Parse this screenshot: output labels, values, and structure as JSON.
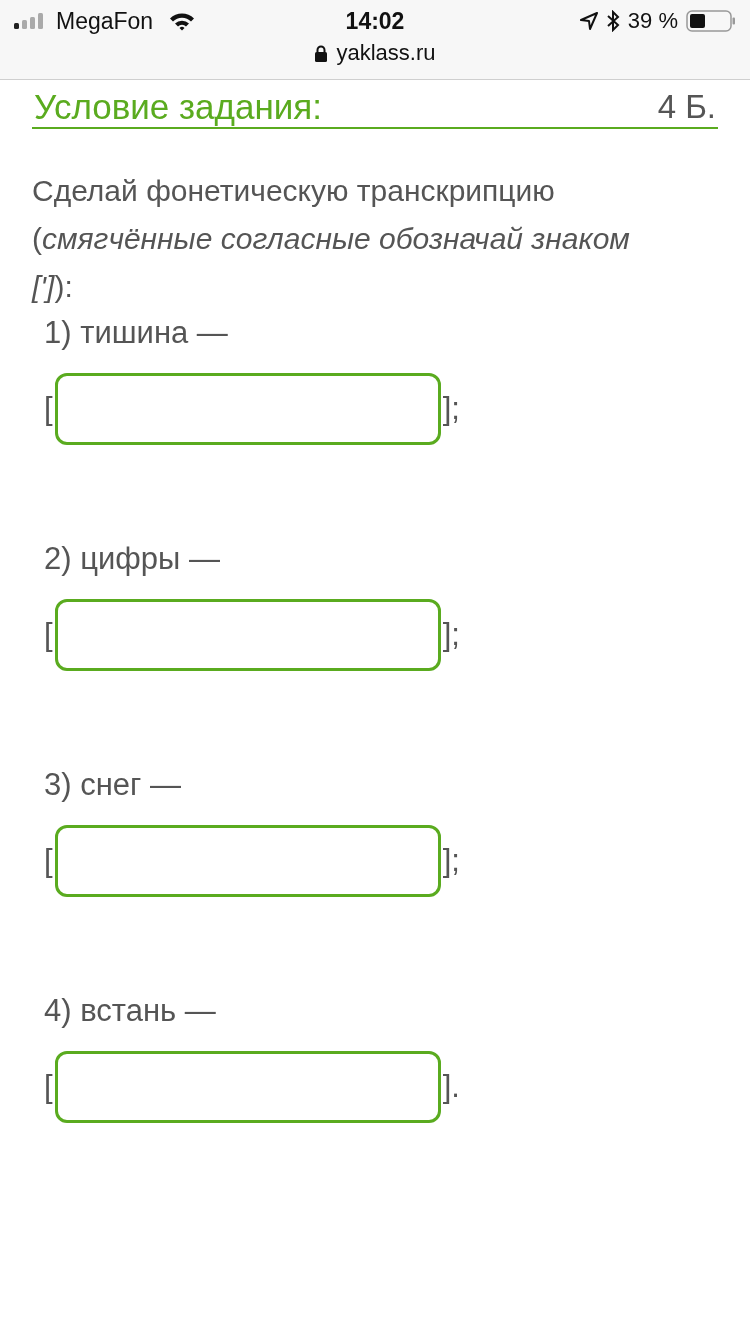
{
  "status_bar": {
    "carrier": "MegaFon",
    "time": "14:02",
    "url": "yaklass.ru",
    "battery": "39 %"
  },
  "header": {
    "title": "Условие задания:",
    "points": "4 Б."
  },
  "instruction": "Сделай фонетическую транскрипцию (*смягчённые согласные обозначай знаком [']*):",
  "items": [
    {
      "word": "1) тишина —",
      "open": "[",
      "close": "];"
    },
    {
      "word": "2) цифры —",
      "open": "[",
      "close": "];"
    },
    {
      "word": "3) снег —",
      "open": "[",
      "close": "];"
    },
    {
      "word": "4) встань —",
      "open": "[",
      "close": "]."
    }
  ]
}
